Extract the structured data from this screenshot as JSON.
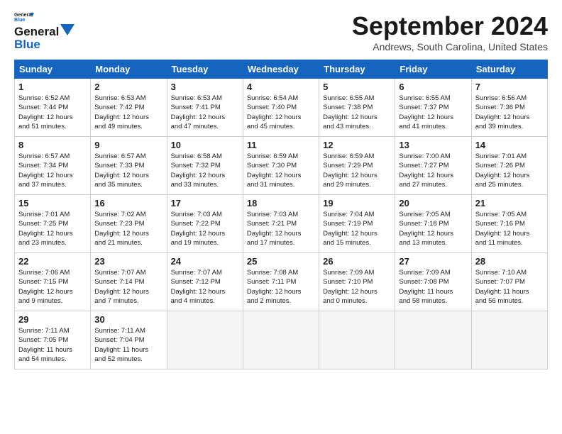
{
  "header": {
    "logo_line1": "General",
    "logo_line2": "Blue",
    "title": "September 2024",
    "location": "Andrews, South Carolina, United States"
  },
  "days_of_week": [
    "Sunday",
    "Monday",
    "Tuesday",
    "Wednesday",
    "Thursday",
    "Friday",
    "Saturday"
  ],
  "weeks": [
    [
      {
        "day": 1,
        "lines": [
          "Sunrise: 6:52 AM",
          "Sunset: 7:44 PM",
          "Daylight: 12 hours",
          "and 51 minutes."
        ]
      },
      {
        "day": 2,
        "lines": [
          "Sunrise: 6:53 AM",
          "Sunset: 7:42 PM",
          "Daylight: 12 hours",
          "and 49 minutes."
        ]
      },
      {
        "day": 3,
        "lines": [
          "Sunrise: 6:53 AM",
          "Sunset: 7:41 PM",
          "Daylight: 12 hours",
          "and 47 minutes."
        ]
      },
      {
        "day": 4,
        "lines": [
          "Sunrise: 6:54 AM",
          "Sunset: 7:40 PM",
          "Daylight: 12 hours",
          "and 45 minutes."
        ]
      },
      {
        "day": 5,
        "lines": [
          "Sunrise: 6:55 AM",
          "Sunset: 7:38 PM",
          "Daylight: 12 hours",
          "and 43 minutes."
        ]
      },
      {
        "day": 6,
        "lines": [
          "Sunrise: 6:55 AM",
          "Sunset: 7:37 PM",
          "Daylight: 12 hours",
          "and 41 minutes."
        ]
      },
      {
        "day": 7,
        "lines": [
          "Sunrise: 6:56 AM",
          "Sunset: 7:36 PM",
          "Daylight: 12 hours",
          "and 39 minutes."
        ]
      }
    ],
    [
      {
        "day": 8,
        "lines": [
          "Sunrise: 6:57 AM",
          "Sunset: 7:34 PM",
          "Daylight: 12 hours",
          "and 37 minutes."
        ]
      },
      {
        "day": 9,
        "lines": [
          "Sunrise: 6:57 AM",
          "Sunset: 7:33 PM",
          "Daylight: 12 hours",
          "and 35 minutes."
        ]
      },
      {
        "day": 10,
        "lines": [
          "Sunrise: 6:58 AM",
          "Sunset: 7:32 PM",
          "Daylight: 12 hours",
          "and 33 minutes."
        ]
      },
      {
        "day": 11,
        "lines": [
          "Sunrise: 6:59 AM",
          "Sunset: 7:30 PM",
          "Daylight: 12 hours",
          "and 31 minutes."
        ]
      },
      {
        "day": 12,
        "lines": [
          "Sunrise: 6:59 AM",
          "Sunset: 7:29 PM",
          "Daylight: 12 hours",
          "and 29 minutes."
        ]
      },
      {
        "day": 13,
        "lines": [
          "Sunrise: 7:00 AM",
          "Sunset: 7:27 PM",
          "Daylight: 12 hours",
          "and 27 minutes."
        ]
      },
      {
        "day": 14,
        "lines": [
          "Sunrise: 7:01 AM",
          "Sunset: 7:26 PM",
          "Daylight: 12 hours",
          "and 25 minutes."
        ]
      }
    ],
    [
      {
        "day": 15,
        "lines": [
          "Sunrise: 7:01 AM",
          "Sunset: 7:25 PM",
          "Daylight: 12 hours",
          "and 23 minutes."
        ]
      },
      {
        "day": 16,
        "lines": [
          "Sunrise: 7:02 AM",
          "Sunset: 7:23 PM",
          "Daylight: 12 hours",
          "and 21 minutes."
        ]
      },
      {
        "day": 17,
        "lines": [
          "Sunrise: 7:03 AM",
          "Sunset: 7:22 PM",
          "Daylight: 12 hours",
          "and 19 minutes."
        ]
      },
      {
        "day": 18,
        "lines": [
          "Sunrise: 7:03 AM",
          "Sunset: 7:21 PM",
          "Daylight: 12 hours",
          "and 17 minutes."
        ]
      },
      {
        "day": 19,
        "lines": [
          "Sunrise: 7:04 AM",
          "Sunset: 7:19 PM",
          "Daylight: 12 hours",
          "and 15 minutes."
        ]
      },
      {
        "day": 20,
        "lines": [
          "Sunrise: 7:05 AM",
          "Sunset: 7:18 PM",
          "Daylight: 12 hours",
          "and 13 minutes."
        ]
      },
      {
        "day": 21,
        "lines": [
          "Sunrise: 7:05 AM",
          "Sunset: 7:16 PM",
          "Daylight: 12 hours",
          "and 11 minutes."
        ]
      }
    ],
    [
      {
        "day": 22,
        "lines": [
          "Sunrise: 7:06 AM",
          "Sunset: 7:15 PM",
          "Daylight: 12 hours",
          "and 9 minutes."
        ]
      },
      {
        "day": 23,
        "lines": [
          "Sunrise: 7:07 AM",
          "Sunset: 7:14 PM",
          "Daylight: 12 hours",
          "and 7 minutes."
        ]
      },
      {
        "day": 24,
        "lines": [
          "Sunrise: 7:07 AM",
          "Sunset: 7:12 PM",
          "Daylight: 12 hours",
          "and 4 minutes."
        ]
      },
      {
        "day": 25,
        "lines": [
          "Sunrise: 7:08 AM",
          "Sunset: 7:11 PM",
          "Daylight: 12 hours",
          "and 2 minutes."
        ]
      },
      {
        "day": 26,
        "lines": [
          "Sunrise: 7:09 AM",
          "Sunset: 7:10 PM",
          "Daylight: 12 hours",
          "and 0 minutes."
        ]
      },
      {
        "day": 27,
        "lines": [
          "Sunrise: 7:09 AM",
          "Sunset: 7:08 PM",
          "Daylight: 11 hours",
          "and 58 minutes."
        ]
      },
      {
        "day": 28,
        "lines": [
          "Sunrise: 7:10 AM",
          "Sunset: 7:07 PM",
          "Daylight: 11 hours",
          "and 56 minutes."
        ]
      }
    ],
    [
      {
        "day": 29,
        "lines": [
          "Sunrise: 7:11 AM",
          "Sunset: 7:05 PM",
          "Daylight: 11 hours",
          "and 54 minutes."
        ]
      },
      {
        "day": 30,
        "lines": [
          "Sunrise: 7:11 AM",
          "Sunset: 7:04 PM",
          "Daylight: 11 hours",
          "and 52 minutes."
        ]
      },
      null,
      null,
      null,
      null,
      null
    ]
  ]
}
